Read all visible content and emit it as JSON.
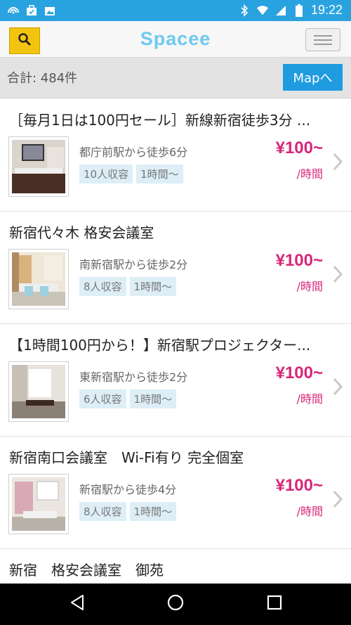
{
  "status_bar": {
    "time": "19:22",
    "icons": [
      "signal-arc-icon",
      "briefcase-icon",
      "image-icon",
      "bluetooth-icon",
      "wifi-icon",
      "cell-signal-icon",
      "battery-icon"
    ]
  },
  "header": {
    "title": "Spacee",
    "search_icon": "search-icon",
    "menu_icon": "hamburger-menu-icon"
  },
  "summary": {
    "total": "合計: 484件",
    "map_button": "Mapへ"
  },
  "colors": {
    "status_bar": "#29a3e0",
    "title": "#6ec9f0",
    "search_button": "#f2c40f",
    "map_button": "#1f9be0",
    "price": "#d8267a",
    "tag_bg": "#ddeef7"
  },
  "listings": [
    {
      "title": "［毎月1日は100円セール］新線新宿徒歩3分 ...",
      "access": "都庁前駅から徒歩6分",
      "capacity": "10人収容",
      "min_time": "1時間〜",
      "price": "¥100~",
      "unit": "/時間"
    },
    {
      "title": "新宿代々木 格安会議室",
      "access": "南新宿駅から徒歩2分",
      "capacity": "8人収容",
      "min_time": "1時間〜",
      "price": "¥100~",
      "unit": "/時間"
    },
    {
      "title": "【1時間100円から！】新宿駅プロジェクター...",
      "access": "東新宿駅から徒歩2分",
      "capacity": "6人収容",
      "min_time": "1時間〜",
      "price": "¥100~",
      "unit": "/時間"
    },
    {
      "title": "新宿南口会議室　Wi-Fi有り 完全個室",
      "access": "新宿駅から徒歩4分",
      "capacity": "8人収容",
      "min_time": "1時間〜",
      "price": "¥100~",
      "unit": "/時間"
    },
    {
      "title": "新宿　格安会議室　御苑"
    }
  ],
  "nav_bar": {
    "back_icon": "back-triangle-icon",
    "home_icon": "home-circle-icon",
    "recents_icon": "recents-square-icon"
  }
}
